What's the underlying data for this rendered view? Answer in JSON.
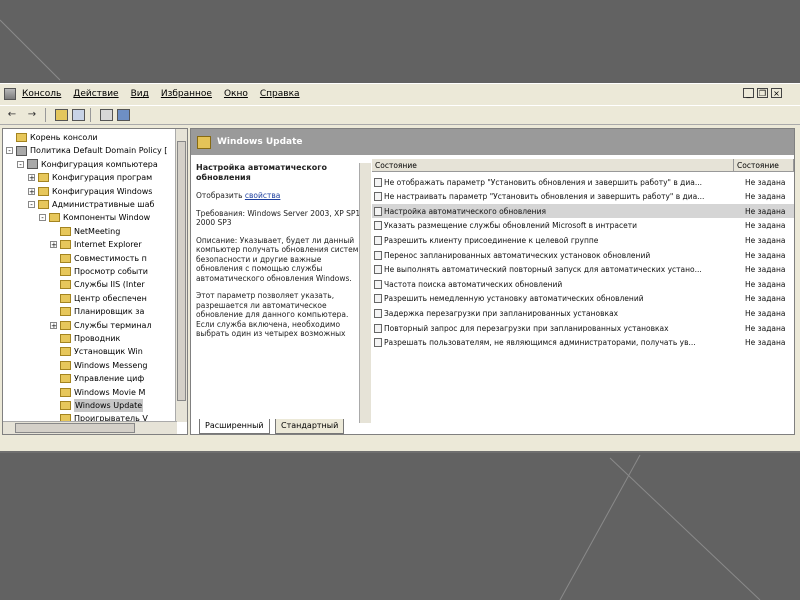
{
  "menu": {
    "items": [
      "Консоль",
      "Действие",
      "Вид",
      "Избранное",
      "Окно",
      "Справка"
    ]
  },
  "tree": {
    "items": [
      {
        "label": "Корень консоли",
        "level": 0,
        "expander": "",
        "icon": "folder"
      },
      {
        "label": "Политика Default Domain Policy [",
        "level": 0,
        "expander": "-",
        "icon": "policy"
      },
      {
        "label": "Конфигурация компьютера",
        "level": 1,
        "expander": "-",
        "icon": "computer"
      },
      {
        "label": "Конфигурация програм",
        "level": 2,
        "expander": "+",
        "icon": "folder"
      },
      {
        "label": "Конфигурация Windows",
        "level": 2,
        "expander": "+",
        "icon": "folder"
      },
      {
        "label": "Административные шаб",
        "level": 2,
        "expander": "-",
        "icon": "folder"
      },
      {
        "label": "Компоненты Window",
        "level": 3,
        "expander": "-",
        "icon": "folder"
      },
      {
        "label": "NetMeeting",
        "level": 4,
        "expander": "",
        "icon": "folder"
      },
      {
        "label": "Internet Explorer",
        "level": 4,
        "expander": "+",
        "icon": "folder"
      },
      {
        "label": "Совместимость п",
        "level": 4,
        "expander": "",
        "icon": "folder"
      },
      {
        "label": "Просмотр событи",
        "level": 4,
        "expander": "",
        "icon": "folder"
      },
      {
        "label": "Службы IIS (Inter",
        "level": 4,
        "expander": "",
        "icon": "folder"
      },
      {
        "label": "Центр обеспечен",
        "level": 4,
        "expander": "",
        "icon": "folder"
      },
      {
        "label": "Планировщик за",
        "level": 4,
        "expander": "",
        "icon": "folder"
      },
      {
        "label": "Службы терминал",
        "level": 4,
        "expander": "+",
        "icon": "folder"
      },
      {
        "label": "Проводник",
        "level": 4,
        "expander": "",
        "icon": "folder"
      },
      {
        "label": "Установщик Win",
        "level": 4,
        "expander": "",
        "icon": "folder"
      },
      {
        "label": "Windows Messeng",
        "level": 4,
        "expander": "",
        "icon": "folder"
      },
      {
        "label": "Управление циф",
        "level": 4,
        "expander": "",
        "icon": "folder"
      },
      {
        "label": "Windows Movie M",
        "level": 4,
        "expander": "",
        "icon": "folder"
      },
      {
        "label": "Windows Update",
        "level": 4,
        "expander": "",
        "icon": "folder"
      },
      {
        "label": "Проигрыватель V",
        "level": 4,
        "expander": "",
        "icon": "folder"
      }
    ],
    "selected_index": 20
  },
  "header": {
    "title": "Windows Update"
  },
  "description": {
    "title": "Настройка автоматического обновления",
    "show_prefix": "Отобразить",
    "show_link": "свойства",
    "requirements": "Требования: Windows Server 2003, XP SP1, 2000 SP3",
    "description_text": "Описание: Указывает, будет ли данный компьютер получать обновления системы безопасности и другие важные обновления с помощью службы автоматического обновления Windows.",
    "extra_text": "Этот параметр позволяет указать, разрешается ли автоматическое обновление для данного компьютера. Если служба включена, необходимо выбрать один из четырех возможных"
  },
  "list": {
    "columns": [
      "Состояние",
      "Состояние"
    ],
    "rows": [
      {
        "name": "Не отображать параметр \"Установить обновления и завершить работу\" в диа...",
        "state": "Не задана"
      },
      {
        "name": "Не настраивать параметр \"Установить обновления и завершить работу\" в диа...",
        "state": "Не задана"
      },
      {
        "name": "Настройка автоматического обновления",
        "state": "Не задана"
      },
      {
        "name": "Указать размещение службы обновлений Microsoft в интрасети",
        "state": "Не задана"
      },
      {
        "name": "Разрешить клиенту присоединение к целевой группе",
        "state": "Не задана"
      },
      {
        "name": "Перенос запланированных автоматических установок обновлений",
        "state": "Не задана"
      },
      {
        "name": "Не выполнять автоматический повторный запуск для автоматических устано...",
        "state": "Не задана"
      },
      {
        "name": "Частота поиска автоматических обновлений",
        "state": "Не задана"
      },
      {
        "name": "Разрешить немедленную установку автоматических обновлений",
        "state": "Не задана"
      },
      {
        "name": "Задержка перезагрузки при запланированных установках",
        "state": "Не задана"
      },
      {
        "name": "Повторный запрос для перезагрузки при запланированных установках",
        "state": "Не задана"
      },
      {
        "name": "Разрешать пользователям, не являющимся администраторами, получать ув...",
        "state": "Не задана"
      }
    ],
    "selected_index": 2
  },
  "tabs": [
    "Расширенный",
    "Стандартный"
  ]
}
